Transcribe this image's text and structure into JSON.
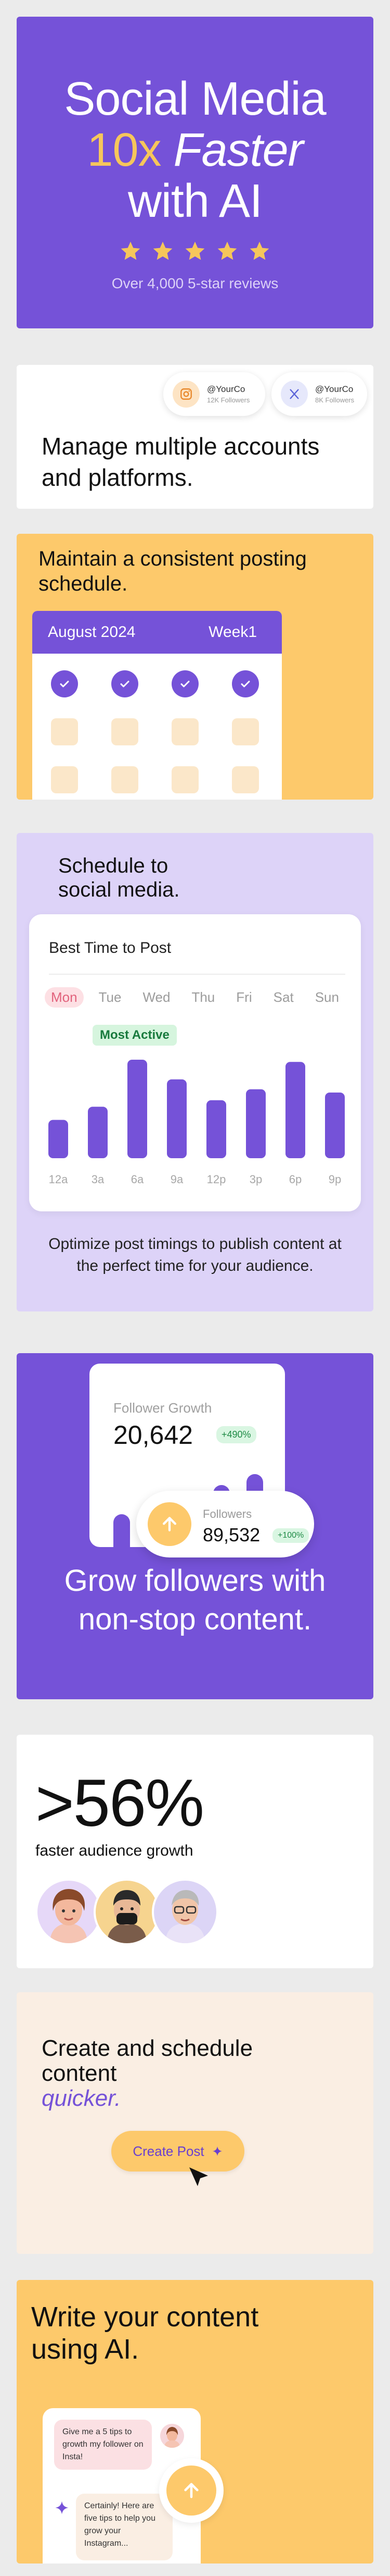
{
  "hero": {
    "line1": "Social Media",
    "line2_highlight": "10x",
    "line2_italic": "Faster",
    "line3": "with AI",
    "stars": 5,
    "reviews": "Over 4,000 5-star reviews"
  },
  "accounts": {
    "items": [
      {
        "platform": "instagram-icon",
        "handle": "@YourCo",
        "followers": "12K Followers"
      },
      {
        "platform": "x-icon",
        "handle": "@YourCo",
        "followers": "8K Followers"
      }
    ],
    "title": "Manage multiple accounts and platforms."
  },
  "schedule": {
    "title": "Maintain a consistent posting schedule.",
    "month": "August 2024",
    "week": "Week1"
  },
  "besttime": {
    "title": "Schedule to social media.",
    "panel_title": "Best Time to Post",
    "days": [
      "Mon",
      "Tue",
      "Wed",
      "Thu",
      "Fri",
      "Sat",
      "Sun"
    ],
    "active_day": "Mon",
    "badge": "Most Active",
    "caption": "Optimize post timings to publish content at the perfect time for your audience.",
    "accent": "#7552d8"
  },
  "chart_data": {
    "type": "bar",
    "categories": [
      "12a",
      "3a",
      "6a",
      "9a",
      "12p",
      "3p",
      "6p",
      "9p"
    ],
    "values": [
      3.5,
      4.7,
      9.0,
      7.2,
      5.3,
      6.3,
      8.8,
      6.0
    ],
    "ylim": [
      0,
      10
    ],
    "title": "Best Time to Post",
    "grid": false
  },
  "growth": {
    "card_label": "Follower Growth",
    "card_value": "20,642",
    "card_change": "+490%",
    "bars": [
      0.45,
      0.7,
      0.6,
      0.85,
      1.0
    ],
    "followers_label": "Followers",
    "followers_value": "89,532",
    "followers_change": "+100%",
    "title": "Grow followers with non-stop content."
  },
  "stat": {
    "big": ">56%",
    "sub": "faster audience growth"
  },
  "create": {
    "title_plain": "Create and schedule content",
    "title_accent": "quicker.",
    "button": "Create Post"
  },
  "write": {
    "title": "Write your content using AI.",
    "user_msg": "Give me a 5 tips to growth my follower on Insta!",
    "ai_msg": "Certainly! Here are five tips to help you grow your Instagram..."
  }
}
